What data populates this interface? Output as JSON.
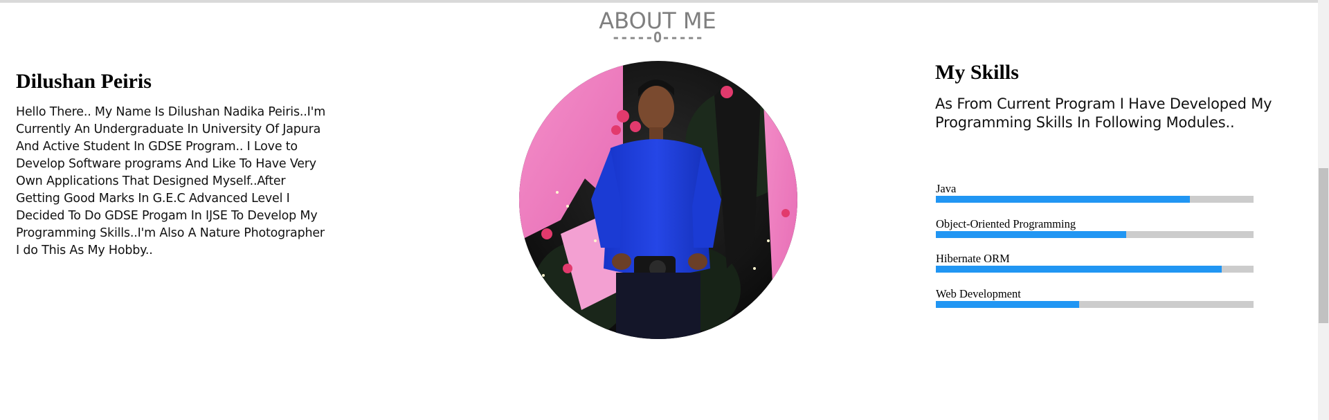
{
  "section": {
    "title": "ABOUT ME",
    "divider": "-----O-----"
  },
  "about": {
    "name": "Dilushan Peiris",
    "description": "Hello There.. My Name Is Dilushan Nadika Peiris..I'm Currently An Undergraduate In University Of Japura And Active Student In GDSE Program.. I Love to Develop Software programs And Like To Have Very Own Applications That Designed Myself..After Getting Good Marks In G.E.C Advanced Level I Decided To Do GDSE Progam In IJSE To Develop My Programming Skills..I'm Also A Nature Photographer I do This As My Hobby.."
  },
  "skills": {
    "title": "My Skills",
    "intro": "As From Current Program I Have Developed My Programming Skills In Following Modules..",
    "items": [
      {
        "label": "Java",
        "percent": 80
      },
      {
        "label": "Object-Oriented Programming",
        "percent": 60
      },
      {
        "label": "Hibernate ORM",
        "percent": 90
      },
      {
        "label": "Web Development",
        "percent": 45
      }
    ]
  },
  "colors": {
    "bar_fill": "#2196f3",
    "bar_track": "#cccccc",
    "title_gray": "#7f7f7f"
  }
}
